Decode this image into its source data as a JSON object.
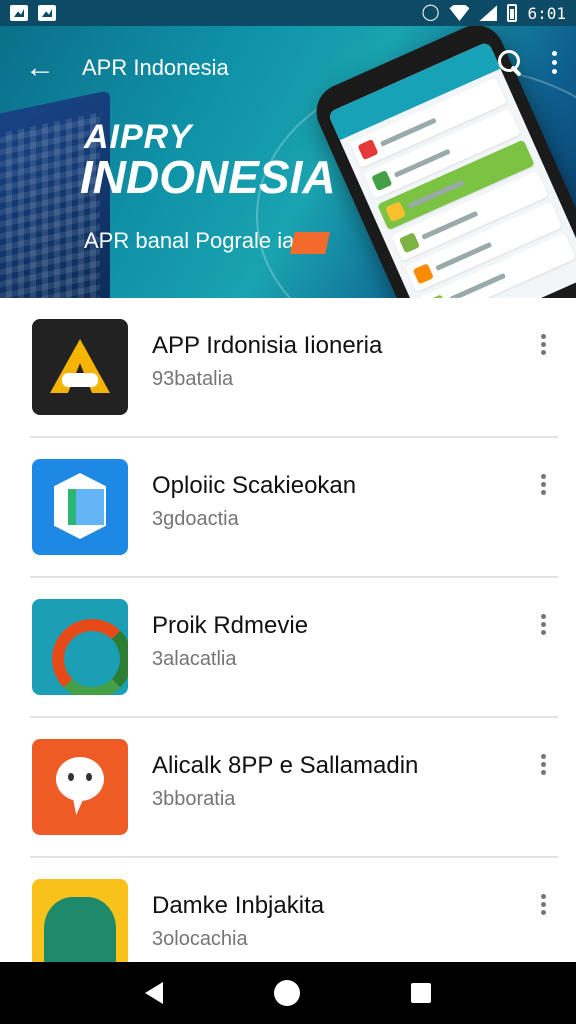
{
  "status_bar": {
    "time": "6:01"
  },
  "app_bar": {
    "title": "APR Indonesia"
  },
  "banner": {
    "line1": "AIPRY",
    "line2": "INDONESIA",
    "subtitle": "APR banal Pograle ia"
  },
  "apps": [
    {
      "title": "APP Irdonisia Iioneria",
      "subtitle": "93batalia",
      "icon": "app-a-icon"
    },
    {
      "title": "Oploiic Scakieokan",
      "subtitle": "3gdoactia",
      "icon": "hexagon-book-icon"
    },
    {
      "title": "Proik Rdmevie",
      "subtitle": "3alacatlia",
      "icon": "ring-icon"
    },
    {
      "title": "Alicalk 8PP e Sallamadin",
      "subtitle": "3bboratia",
      "icon": "chat-bubble-icon"
    },
    {
      "title": "Damke Inbjakita",
      "subtitle": "3olocachia",
      "icon": "monster-icon"
    }
  ],
  "colors": {
    "status_bar": "#0d4a66",
    "banner_accent": "#0f93a8",
    "divider": "#e3e3e3",
    "subtitle": "#757575"
  }
}
